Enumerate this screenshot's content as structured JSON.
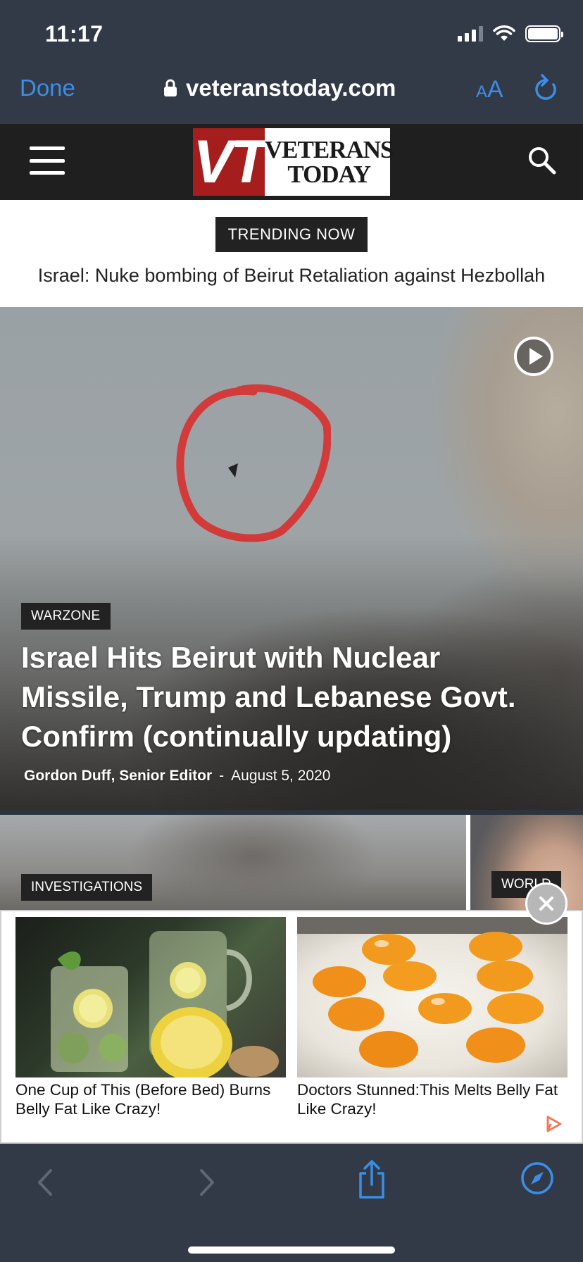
{
  "status_bar": {
    "time": "11:17"
  },
  "address_bar": {
    "done_label": "Done",
    "url": "veteranstoday.com",
    "text_size_small": "A",
    "text_size_large": "A"
  },
  "site_header": {
    "logo_mark": "VT",
    "logo_line1": "VETERANS",
    "logo_line2": "TODAY"
  },
  "trending": {
    "badge": "TRENDING NOW",
    "headline": "Israel: Nuke bombing of Beirut Retaliation against Hezbollah"
  },
  "hero": {
    "category": "WARZONE",
    "title": "Israel Hits Beirut with Nuclear Missile, Trump and Lebanese Govt. Confirm (continually updating)",
    "author": "Gordon Duff, Senior Editor",
    "separator": "-",
    "date": "August 5, 2020"
  },
  "cards": [
    {
      "category": "INVESTIGATIONS"
    },
    {
      "category": "WORLD"
    }
  ],
  "ad": {
    "items": [
      {
        "caption": "One Cup of This (Before Bed) Burns Belly Fat Like Crazy!"
      },
      {
        "caption": "Doctors Stunned:This Melts Belly Fat Like Crazy!"
      }
    ]
  },
  "colors": {
    "chrome_bg": "#323a47",
    "link_blue": "#3b8ee8",
    "logo_red": "#a51d1d",
    "header_bg": "#1f1f1f"
  }
}
